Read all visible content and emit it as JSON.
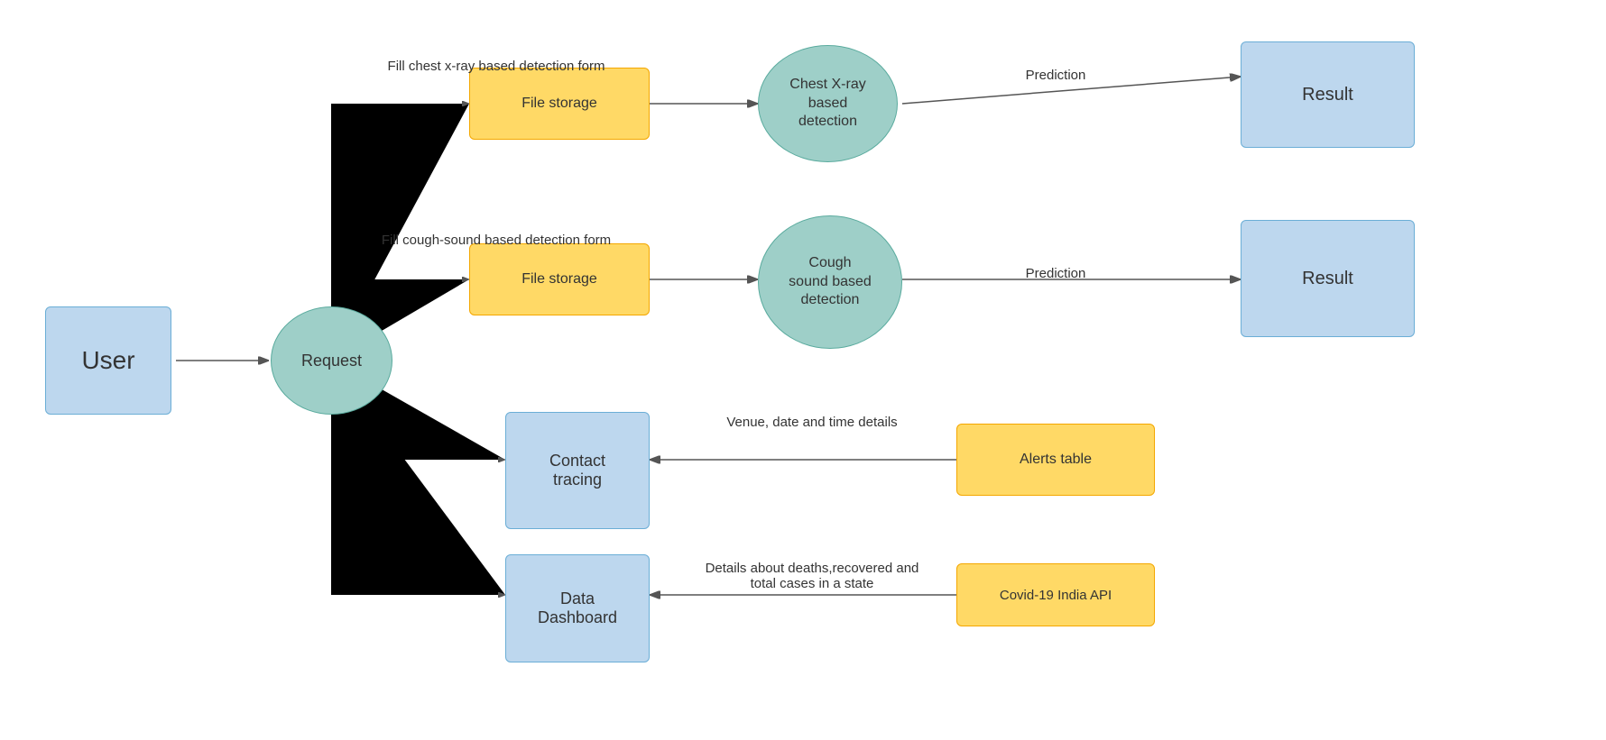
{
  "nodes": {
    "user": {
      "label": "User"
    },
    "request": {
      "label": "Request"
    },
    "file_storage_1": {
      "label": "File storage"
    },
    "chest_xray": {
      "label": "Chest X-ray\nbased\ndetection"
    },
    "result_1": {
      "label": "Result"
    },
    "file_storage_2": {
      "label": "File storage"
    },
    "cough_sound": {
      "label": "Cough\nsound based\ndetection"
    },
    "result_2": {
      "label": "Result"
    },
    "contact_tracing": {
      "label": "Contact\ntracing"
    },
    "alerts_table": {
      "label": "Alerts table"
    },
    "data_dashboard": {
      "label": "Data\nDashboard"
    },
    "covid_api": {
      "label": "Covid-19 India API"
    }
  },
  "labels": {
    "xray_form": "Fill chest x-ray based detection form",
    "cough_form": "Fill cough-sound based detection form",
    "prediction_1": "Prediction",
    "prediction_2": "Prediction",
    "venue_details": "Venue, date and time details",
    "death_details": "Details about deaths,recovered and\ntotal cases in a state"
  }
}
